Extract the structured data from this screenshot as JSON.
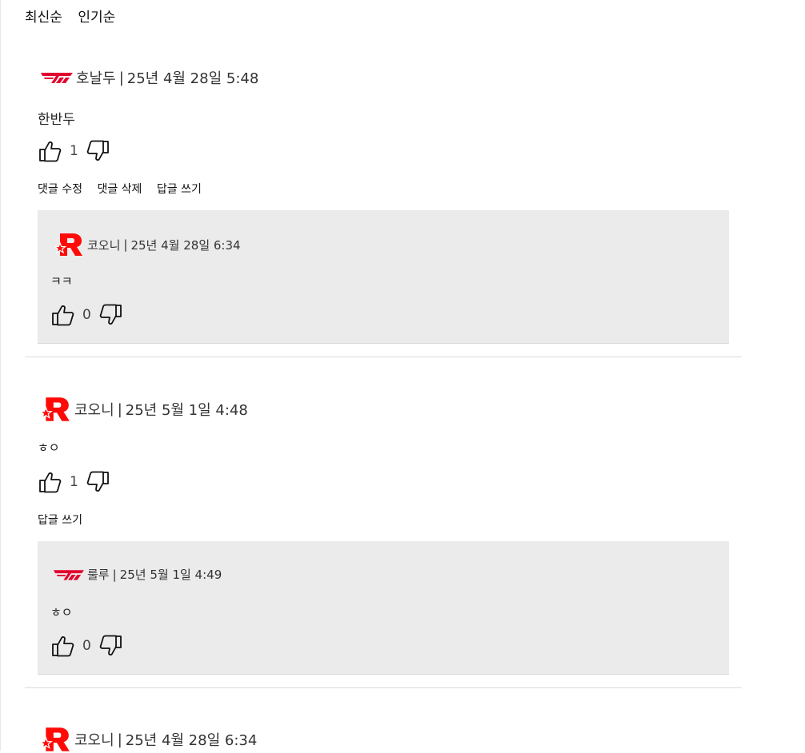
{
  "sort": {
    "latest": "최신순",
    "popular": "인기순"
  },
  "colors": {
    "t1_red": "#e2012d",
    "kt_red": "#ff0a07",
    "reply_bg": "#ebebeb"
  },
  "comments": [
    {
      "team_logo": "t1-logo",
      "author": "호날두",
      "separator": "|",
      "time": "25년 4월 28일 5:48",
      "body": "한반두",
      "likes": "1",
      "actions": {
        "edit": "댓글 수정",
        "delete": "댓글 삭제",
        "reply": "답글 쓰기"
      },
      "reply": {
        "team_logo": "kt-rolster-logo",
        "author": "코오니",
        "separator": "|",
        "time": "25년 4월 28일 6:34",
        "body": "ㅋㅋ",
        "likes": "0"
      }
    },
    {
      "team_logo": "kt-rolster-logo",
      "author": "코오니",
      "separator": "|",
      "time": "25년 5월 1일 4:48",
      "body": "ㅎㅇ",
      "likes": "1",
      "actions": {
        "reply": "답글 쓰기"
      },
      "reply": {
        "team_logo": "t1-logo",
        "author": "룰루",
        "separator": "|",
        "time": "25년 5월 1일 4:49",
        "body": "ㅎㅇ",
        "likes": "0"
      }
    },
    {
      "team_logo": "kt-rolster-logo",
      "author": "코오니",
      "separator": "|",
      "time": "25년 4월 28일 6:34"
    }
  ]
}
